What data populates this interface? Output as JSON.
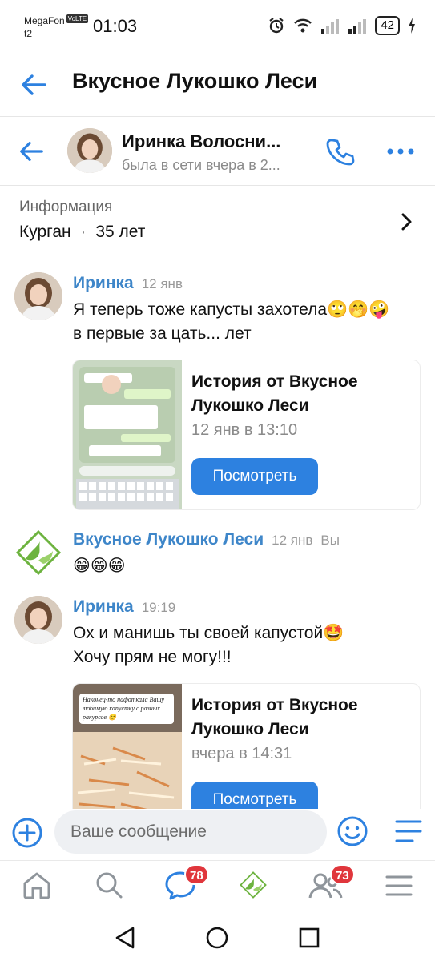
{
  "status_bar": {
    "carrier": "MegaFon",
    "volte": "VoLTE",
    "carrier2": "t2",
    "time": "01:03",
    "battery": "42"
  },
  "app_header": {
    "title": "Вкусное Лукошко Леси"
  },
  "chat_header": {
    "name": "Иринка Волосни...",
    "status": "была в сети вчера в 2..."
  },
  "info": {
    "label": "Информация",
    "city": "Курган",
    "separator": "·",
    "age": "35 лет"
  },
  "messages": [
    {
      "author": "Иринка",
      "time": "12 янв",
      "line1": "Я теперь тоже капусты захотела🙄🤭🤪",
      "line2": "в первые за цать... лет",
      "story": {
        "title": "История от Вкусное Лукошко Леси",
        "date": "12 янв в 13:10",
        "button": "Посмотреть"
      }
    },
    {
      "author": "Вкусное Лукошко Леси",
      "time": "12 янв",
      "you": "Вы",
      "line1": "😁😁😁"
    },
    {
      "author": "Иринка",
      "time": "19:19",
      "line1": "Ох и манишь ты своей капустой🤩",
      "line2": "Хочу прям не могу!!!",
      "story": {
        "title": "История от Вкусное Лукошко Леси",
        "date": "вчера в 14:31",
        "button": "Посмотреть",
        "thumb_caption": "Наконец-то нафоткала Вашу любимую капустку с разных ракурсов 😊"
      }
    }
  ],
  "composer": {
    "placeholder": "Ваше сообщение"
  },
  "tabbar": {
    "messages_badge": "78",
    "friends_badge": "73"
  },
  "colors": {
    "accent": "#2d81e0",
    "author": "#3e86c9",
    "badge": "#e0363c"
  }
}
